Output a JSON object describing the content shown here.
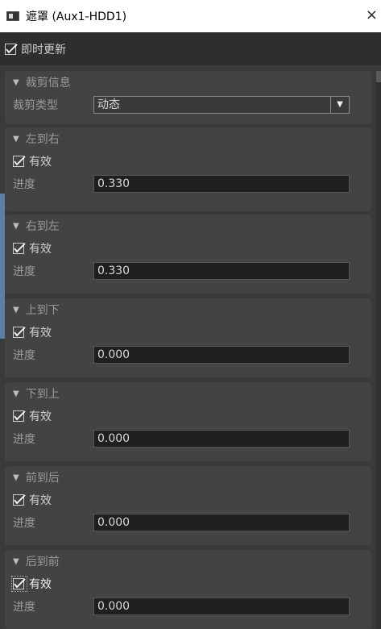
{
  "window": {
    "title": "遮罩 (Aux1-HDD1)",
    "close": "×"
  },
  "realtime": {
    "label": "即时更新",
    "checked": true
  },
  "crop": {
    "header": "裁剪信息",
    "type_label": "裁剪类型",
    "type_value": "动态"
  },
  "sections": [
    {
      "header": "左到右",
      "valid_label": "有效",
      "progress_label": "进度",
      "progress_value": "0.330"
    },
    {
      "header": "右到左",
      "valid_label": "有效",
      "progress_label": "进度",
      "progress_value": "0.330"
    },
    {
      "header": "上到下",
      "valid_label": "有效",
      "progress_label": "进度",
      "progress_value": "0.000"
    },
    {
      "header": "下到上",
      "valid_label": "有效",
      "progress_label": "进度",
      "progress_value": "0.000"
    },
    {
      "header": "前到后",
      "valid_label": "有效",
      "progress_label": "进度",
      "progress_value": "0.000"
    },
    {
      "header": "后到前",
      "valid_label": "有效",
      "progress_label": "进度",
      "progress_value": "0.000"
    }
  ],
  "icons": {
    "collapse": "triangle-down-icon",
    "check": "checkmark-icon",
    "dropdown": "dropdown-arrow-icon"
  }
}
